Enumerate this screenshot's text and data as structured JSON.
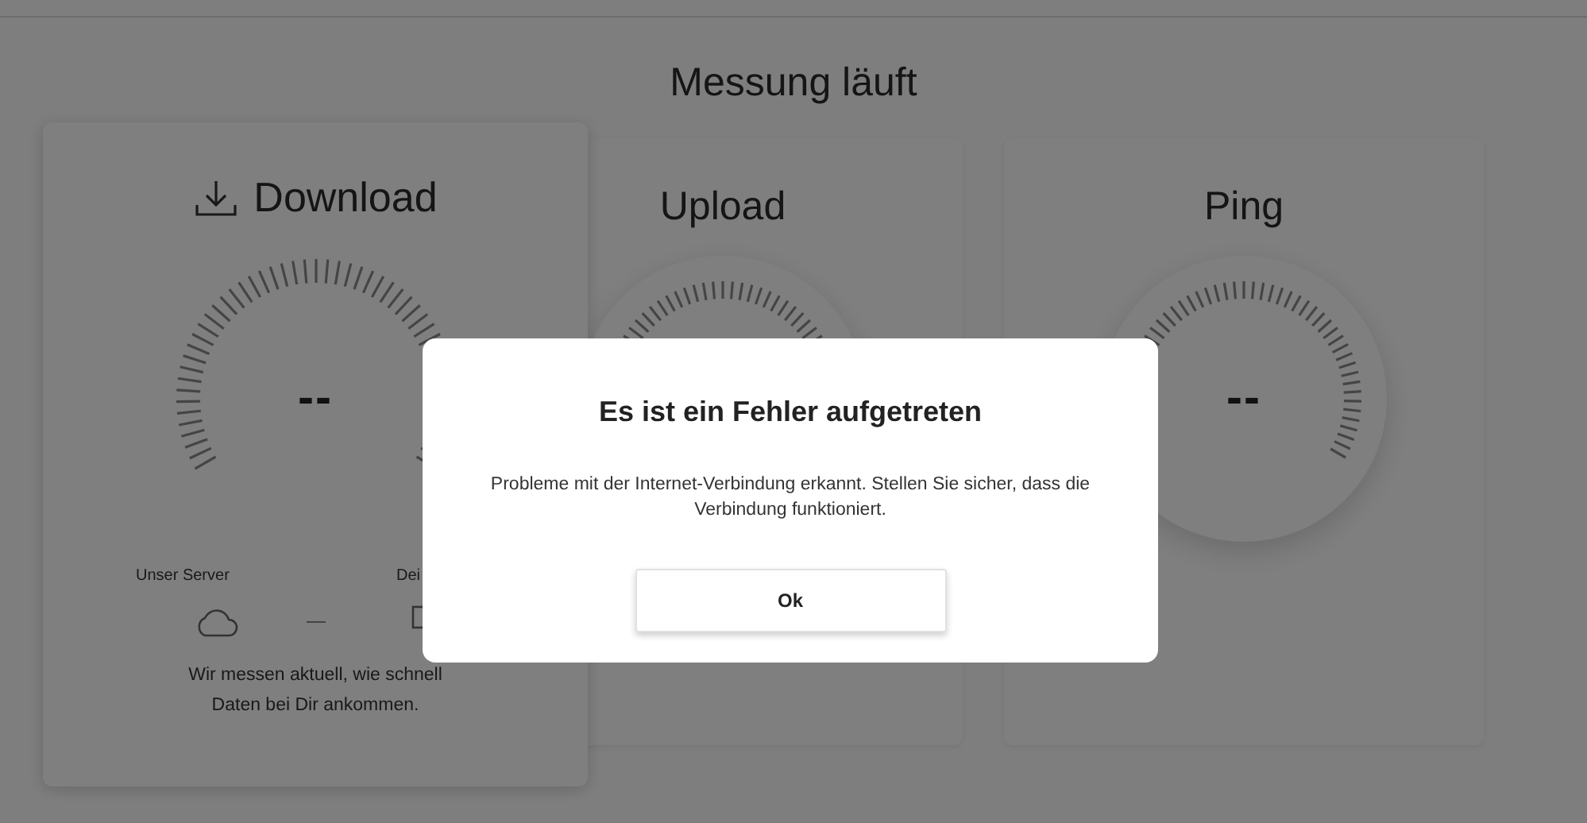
{
  "header": {
    "title": "Messung läuft"
  },
  "cards": [
    {
      "title": "Download",
      "selected": true,
      "value": "--",
      "endpoints": [
        {
          "label": "Unser Server",
          "kind": "server"
        },
        {
          "label": "Dei",
          "kind": "device"
        }
      ],
      "description": "Wir messen aktuell, wie schnell Daten bei Dir ankommen."
    },
    {
      "title": "Upload",
      "selected": false
    },
    {
      "title": "Ping",
      "selected": false,
      "value": "--"
    }
  ],
  "dialog": {
    "title": "Es ist ein Fehler aufgetreten",
    "message": "Probleme mit der Internet-Verbindung erkannt. Stellen Sie sicher, dass die Verbindung funktioniert.",
    "buttons": [
      "Ok"
    ]
  }
}
